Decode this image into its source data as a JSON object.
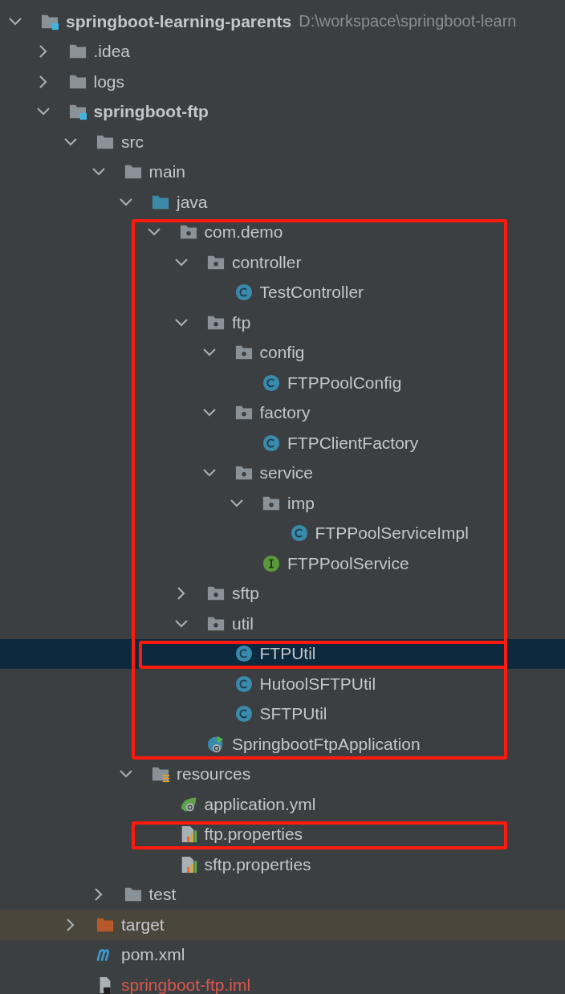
{
  "project_tree": {
    "name": "springboot-learning-parents",
    "kind": "module",
    "path": "D:\\workspace\\springboot-learn",
    "expanded": true,
    "selected": false,
    "children": [
      {
        "name": ".idea",
        "kind": "folder",
        "expanded": false,
        "selected": false
      },
      {
        "name": "logs",
        "kind": "folder",
        "expanded": false,
        "selected": false
      },
      {
        "name": "springboot-ftp",
        "kind": "module",
        "expanded": true,
        "selected": false,
        "children": [
          {
            "name": "src",
            "kind": "folder",
            "expanded": true,
            "selected": false,
            "children": [
              {
                "name": "main",
                "kind": "folder",
                "expanded": true,
                "selected": false,
                "children": [
                  {
                    "name": "java",
                    "kind": "source-folder",
                    "expanded": true,
                    "selected": false,
                    "children": [
                      {
                        "name": "com.demo",
                        "kind": "package",
                        "expanded": true,
                        "selected": false,
                        "boxed": true,
                        "children": [
                          {
                            "name": "controller",
                            "kind": "package",
                            "expanded": true,
                            "selected": false,
                            "children": [
                              {
                                "name": "TestController",
                                "kind": "class",
                                "selected": false
                              }
                            ]
                          },
                          {
                            "name": "ftp",
                            "kind": "package",
                            "expanded": true,
                            "selected": false,
                            "children": [
                              {
                                "name": "config",
                                "kind": "package",
                                "expanded": true,
                                "selected": false,
                                "children": [
                                  {
                                    "name": "FTPPoolConfig",
                                    "kind": "class",
                                    "selected": false
                                  }
                                ]
                              },
                              {
                                "name": "factory",
                                "kind": "package",
                                "expanded": true,
                                "selected": false,
                                "children": [
                                  {
                                    "name": "FTPClientFactory",
                                    "kind": "class",
                                    "selected": false
                                  }
                                ]
                              },
                              {
                                "name": "service",
                                "kind": "package",
                                "expanded": true,
                                "selected": false,
                                "children": [
                                  {
                                    "name": "imp",
                                    "kind": "package",
                                    "expanded": true,
                                    "selected": false,
                                    "children": [
                                      {
                                        "name": "FTPPoolServiceImpl",
                                        "kind": "class",
                                        "selected": false
                                      }
                                    ]
                                  },
                                  {
                                    "name": "FTPPoolService",
                                    "kind": "interface",
                                    "selected": false
                                  }
                                ]
                              }
                            ]
                          },
                          {
                            "name": "sftp",
                            "kind": "package",
                            "expanded": false,
                            "selected": false
                          },
                          {
                            "name": "util",
                            "kind": "package",
                            "expanded": true,
                            "selected": false,
                            "children": [
                              {
                                "name": "FTPUtil",
                                "kind": "class",
                                "selected": true,
                                "boxed": true
                              },
                              {
                                "name": "HutoolSFTPUtil",
                                "kind": "class",
                                "selected": false
                              },
                              {
                                "name": "SFTPUtil",
                                "kind": "class",
                                "selected": false
                              }
                            ]
                          },
                          {
                            "name": "SpringbootFtpApplication",
                            "kind": "spring-app",
                            "selected": false
                          }
                        ]
                      }
                    ]
                  },
                  {
                    "name": "resources",
                    "kind": "resources-folder",
                    "expanded": true,
                    "selected": false,
                    "children": [
                      {
                        "name": "application.yml",
                        "kind": "yaml",
                        "selected": false
                      },
                      {
                        "name": "ftp.properties",
                        "kind": "properties",
                        "selected": false,
                        "boxed": true
                      },
                      {
                        "name": "sftp.properties",
                        "kind": "properties",
                        "selected": false
                      }
                    ]
                  }
                ]
              },
              {
                "name": "test",
                "kind": "folder",
                "expanded": false,
                "selected": false
              }
            ]
          },
          {
            "name": "target",
            "kind": "excluded-folder",
            "expanded": false,
            "selected": false
          },
          {
            "name": "pom.xml",
            "kind": "maven",
            "selected": false
          },
          {
            "name": "springboot-ftp.iml",
            "kind": "iml",
            "selected": false,
            "color": "#d9574e"
          }
        ]
      }
    ]
  }
}
